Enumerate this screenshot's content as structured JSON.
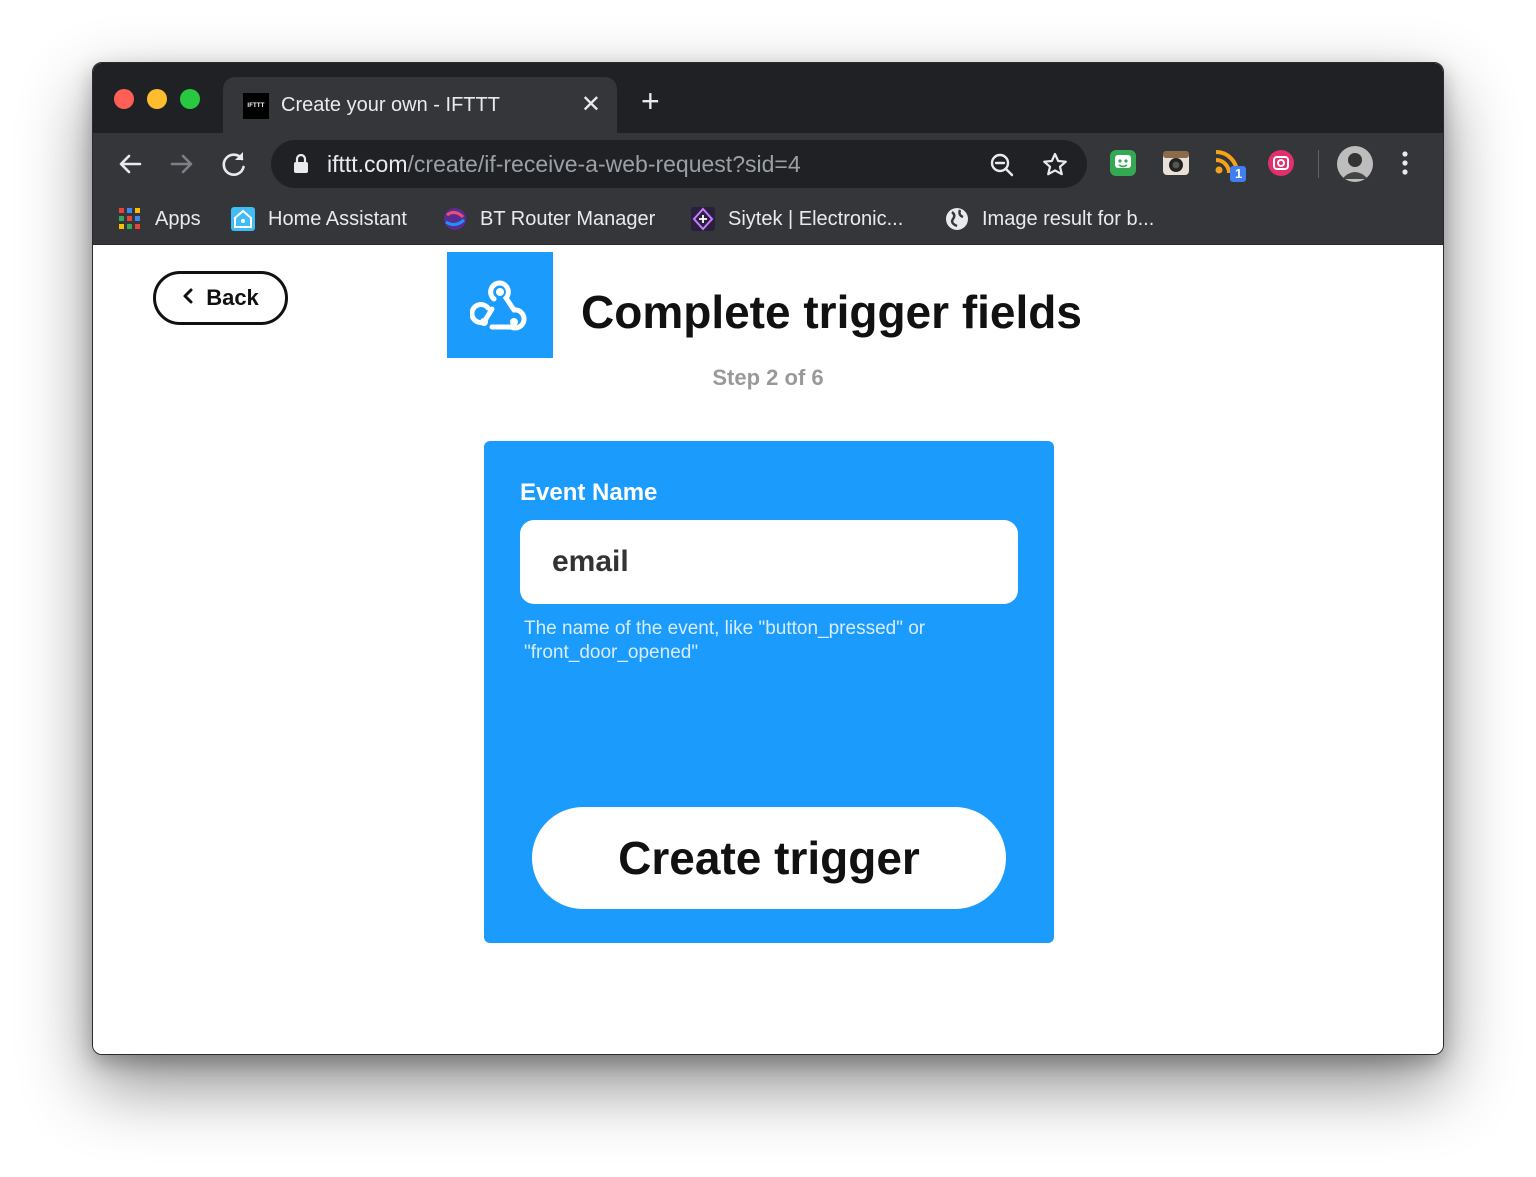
{
  "browser": {
    "tab": {
      "title": "Create your own - IFTTT",
      "favicon_text": "IFTTT",
      "close_glyph": "✕"
    },
    "new_tab_glyph": "+",
    "address": {
      "host": "ifttt.com",
      "path": "/create/if-receive-a-web-request?sid=4"
    },
    "extension_badge": "1",
    "bookmarks": [
      {
        "label": "Apps",
        "icon": "apps-grid-icon"
      },
      {
        "label": "Home Assistant",
        "icon": "home-assistant-icon"
      },
      {
        "label": "BT Router Manager",
        "icon": "bt-globe-icon"
      },
      {
        "label": "Siytek | Electronic...",
        "icon": "siytek-icon"
      },
      {
        "label": "Image result for b...",
        "icon": "globe-icon"
      }
    ]
  },
  "page": {
    "back_label": "Back",
    "title": "Complete trigger fields",
    "step": "Step 2 of 6",
    "service_icon": "webhooks-icon",
    "field": {
      "label": "Event Name",
      "value": "email",
      "help": "The name of the event, like \"button_pressed\" or \"front_door_opened\""
    },
    "submit_label": "Create trigger"
  },
  "colors": {
    "accent": "#1b9cfc",
    "chrome_dark": "#202124",
    "chrome_toolbar": "#35363a"
  }
}
